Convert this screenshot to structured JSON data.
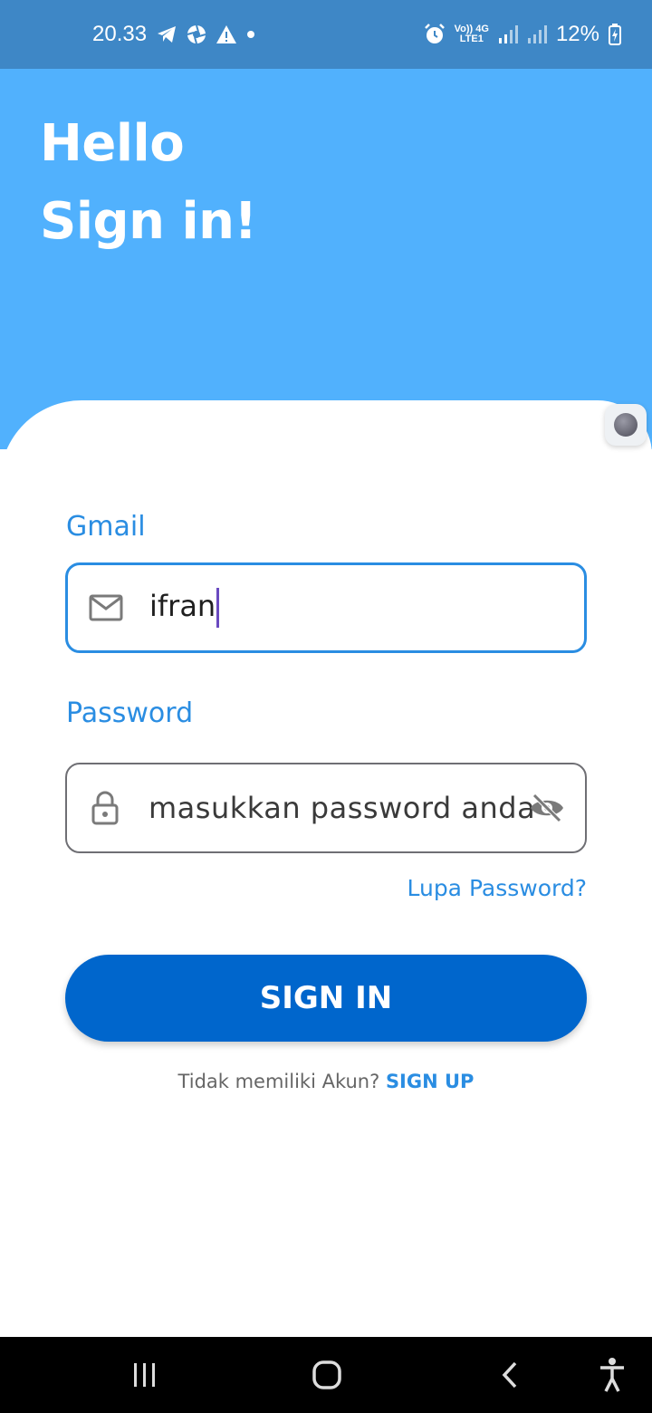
{
  "status_bar": {
    "time": "20.33",
    "left_icons": [
      "telegram-icon",
      "aperture-icon",
      "warning-icon",
      "dot-icon"
    ],
    "network_label_top": "Vo)) 4G",
    "network_label_bottom": "LTE1",
    "battery": "12%",
    "right_icons": [
      "alarm-icon",
      "signal-icon",
      "signal-icon",
      "battery-charging-icon"
    ]
  },
  "header": {
    "line1": "Hello",
    "line2": "Sign in!"
  },
  "form": {
    "email_label": "Gmail",
    "email_value": "ifran",
    "password_label": "Password",
    "password_placeholder": "masukkan password anda",
    "forgot_link": "Lupa Password?",
    "signin_button": "SIGN IN",
    "signup_prompt": "Tidak memiliki Akun? ",
    "signup_link": "SIGN UP"
  },
  "colors": {
    "status_bar": "#3e87c6",
    "header_bg": "#51b1fd",
    "accent": "#2a8de2",
    "button": "#0066cc"
  }
}
